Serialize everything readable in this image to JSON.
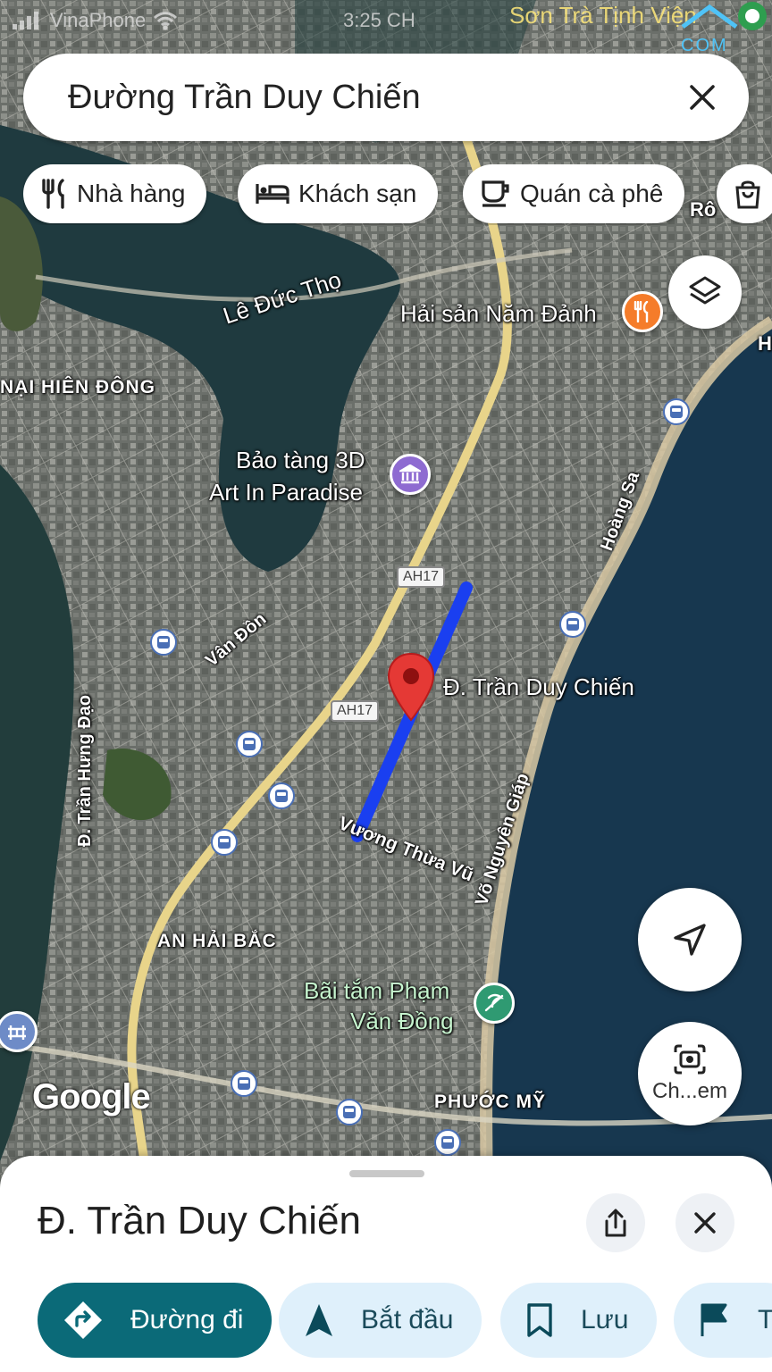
{
  "status_bar": {
    "carrier": "VinaPhone",
    "time": "3:25 CH",
    "overlay_text": "Sơn Trà Tịnh Viện",
    "watermark_suffix": "COM"
  },
  "search": {
    "query": "Đường Trần Duy Chiến"
  },
  "chips": [
    {
      "label": "Nhà hàng",
      "icon": "fork-knife-icon"
    },
    {
      "label": "Khách sạn",
      "icon": "bed-icon"
    },
    {
      "label": "Quán cà phê",
      "icon": "coffee-cup-icon"
    },
    {
      "label": "",
      "icon": "shopping-bag-icon"
    }
  ],
  "map": {
    "labels": {
      "le_duc_tho": "Lê Đức Thọ",
      "nai_hien_dong": "NẠI HIÊN ĐÔNG",
      "hai_san": "Hải sản Năm Đảnh",
      "bao_tang_1": "Bảo tàng 3D",
      "bao_tang_2": "Art In Paradise",
      "hoang_sa": "Hoàng Sa",
      "van_don": "Vân Đồn",
      "route_name": "Đ. Trần Duy Chiến",
      "tran_hung_dao": "Đ. Trần Hưng Đạo",
      "vuong_thua_vu": "Vương Thừa Vũ",
      "vo_nguyen_giap": "Võ Nguyên Giáp",
      "an_hai_bac": "AN HẢI BẮC",
      "bai_tam_1": "Bãi tắm Phạm",
      "bai_tam_2": "Văn Đồng",
      "phuoc_my": "PHƯỚC MỸ",
      "ro": "Rô",
      "h_edge": "H"
    },
    "shields": [
      "AH17",
      "AH17"
    ],
    "attribution": "Google",
    "colors": {
      "route": "#1a3ff0",
      "pin": "#e53935",
      "restaurant_poi": "#f57c2a",
      "museum_poi": "#8e6bd1",
      "beach_poi": "#2f9a72"
    }
  },
  "buttons": {
    "layers": "layers-icon",
    "locate": "navigation-arrow-icon",
    "camera_label": "Ch...em"
  },
  "sheet": {
    "title": "Đ. Trần Duy Chiến",
    "actions": [
      {
        "label": "Đường đi",
        "icon": "directions-icon"
      },
      {
        "label": "Bắt đầu",
        "icon": "navigate-icon"
      },
      {
        "label": "Lưu",
        "icon": "bookmark-icon"
      },
      {
        "label": "T",
        "icon": "flag-icon"
      }
    ]
  }
}
